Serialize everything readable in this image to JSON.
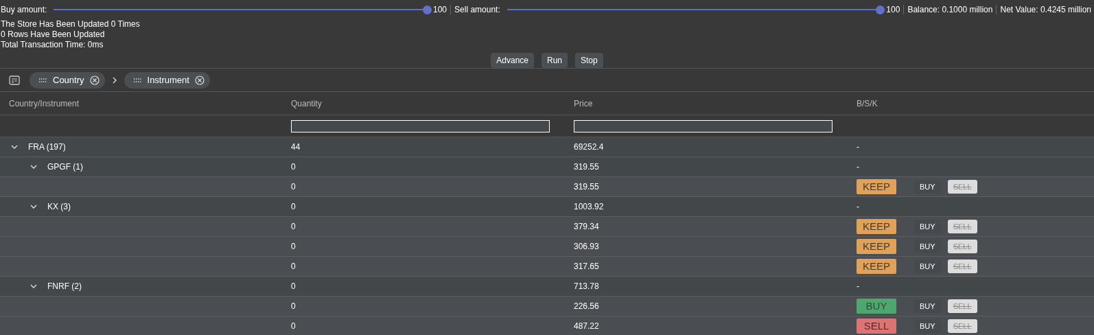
{
  "controls": {
    "buy": {
      "label": "Buy amount:",
      "level": 1,
      "reading": "100"
    },
    "sell": {
      "label": "Sell amount:",
      "level": 1,
      "reading": "100"
    },
    "balance": "Balance: 0.1000 million",
    "net_value": "Net Value: 0.4245 million"
  },
  "status_lines": [
    "The Store Has Been Updated 0 Times",
    "0 Rows Have Been Updated",
    "Total Transaction Time: 0ms"
  ],
  "buttons": [
    "Advance",
    "Run",
    "Stop"
  ],
  "group_panel": {
    "chips": [
      "Country",
      "Instrument"
    ]
  },
  "table": {
    "columns": [
      "Country/Instrument",
      "Quantity",
      "Price",
      "B/S/K"
    ],
    "filters": [
      {
        "kind": "none"
      },
      {
        "kind": "input"
      },
      {
        "kind": "input"
      },
      {
        "kind": "none"
      }
    ],
    "rows": [
      {
        "label": "FRA (197)",
        "quantity": "44",
        "price": "69252.4",
        "bsk": "-",
        "expanded": true,
        "children": [
          {
            "label": "GPGF (1)",
            "quantity": "0",
            "price": "319.55",
            "bsk": "-",
            "expanded": true,
            "children": [
              {
                "quantity": "0",
                "price": "319.55",
                "signal": {
                  "kind": "keep",
                  "text": "KEEP"
                },
                "buy": {
                  "text": "BUY",
                  "disabled": false
                },
                "sell": {
                  "text": "SELL",
                  "disabled": true
                }
              }
            ]
          },
          {
            "label": "KX (3)",
            "quantity": "0",
            "price": "1003.92",
            "bsk": "-",
            "expanded": true,
            "children": [
              {
                "quantity": "0",
                "price": "379.34",
                "signal": {
                  "kind": "keep",
                  "text": "KEEP"
                },
                "buy": {
                  "text": "BUY",
                  "disabled": false
                },
                "sell": {
                  "text": "SELL",
                  "disabled": true
                }
              },
              {
                "quantity": "0",
                "price": "306.93",
                "signal": {
                  "kind": "keep",
                  "text": "KEEP"
                },
                "buy": {
                  "text": "BUY",
                  "disabled": false
                },
                "sell": {
                  "text": "SELL",
                  "disabled": true
                }
              },
              {
                "quantity": "0",
                "price": "317.65",
                "signal": {
                  "kind": "keep",
                  "text": "KEEP"
                },
                "buy": {
                  "text": "BUY",
                  "disabled": false
                },
                "sell": {
                  "text": "SELL",
                  "disabled": true
                }
              }
            ]
          },
          {
            "label": "FNRF (2)",
            "quantity": "0",
            "price": "713.78",
            "bsk": "-",
            "expanded": true,
            "children": [
              {
                "quantity": "0",
                "price": "226.56",
                "signal": {
                  "kind": "buy",
                  "text": "BUY"
                },
                "buy": {
                  "text": "BUY",
                  "disabled": false
                },
                "sell": {
                  "text": "SELL",
                  "disabled": true
                }
              },
              {
                "quantity": "0",
                "price": "487.22",
                "signal": {
                  "kind": "sell",
                  "text": "SELL"
                },
                "buy": {
                  "text": "BUY",
                  "disabled": false
                },
                "sell": {
                  "text": "SELL",
                  "disabled": true
                }
              }
            ]
          }
        ]
      }
    ]
  }
}
